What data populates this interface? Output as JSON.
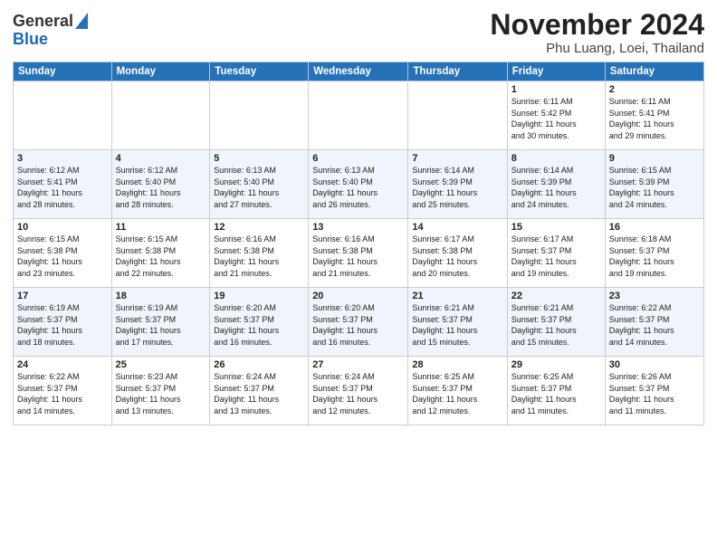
{
  "header": {
    "logo_general": "General",
    "logo_blue": "Blue",
    "month_title": "November 2024",
    "location": "Phu Luang, Loei, Thailand"
  },
  "days_of_week": [
    "Sunday",
    "Monday",
    "Tuesday",
    "Wednesday",
    "Thursday",
    "Friday",
    "Saturday"
  ],
  "weeks": [
    [
      {
        "day": "",
        "info": ""
      },
      {
        "day": "",
        "info": ""
      },
      {
        "day": "",
        "info": ""
      },
      {
        "day": "",
        "info": ""
      },
      {
        "day": "",
        "info": ""
      },
      {
        "day": "1",
        "info": "Sunrise: 6:11 AM\nSunset: 5:42 PM\nDaylight: 11 hours\nand 30 minutes."
      },
      {
        "day": "2",
        "info": "Sunrise: 6:11 AM\nSunset: 5:41 PM\nDaylight: 11 hours\nand 29 minutes."
      }
    ],
    [
      {
        "day": "3",
        "info": "Sunrise: 6:12 AM\nSunset: 5:41 PM\nDaylight: 11 hours\nand 28 minutes."
      },
      {
        "day": "4",
        "info": "Sunrise: 6:12 AM\nSunset: 5:40 PM\nDaylight: 11 hours\nand 28 minutes."
      },
      {
        "day": "5",
        "info": "Sunrise: 6:13 AM\nSunset: 5:40 PM\nDaylight: 11 hours\nand 27 minutes."
      },
      {
        "day": "6",
        "info": "Sunrise: 6:13 AM\nSunset: 5:40 PM\nDaylight: 11 hours\nand 26 minutes."
      },
      {
        "day": "7",
        "info": "Sunrise: 6:14 AM\nSunset: 5:39 PM\nDaylight: 11 hours\nand 25 minutes."
      },
      {
        "day": "8",
        "info": "Sunrise: 6:14 AM\nSunset: 5:39 PM\nDaylight: 11 hours\nand 24 minutes."
      },
      {
        "day": "9",
        "info": "Sunrise: 6:15 AM\nSunset: 5:39 PM\nDaylight: 11 hours\nand 24 minutes."
      }
    ],
    [
      {
        "day": "10",
        "info": "Sunrise: 6:15 AM\nSunset: 5:38 PM\nDaylight: 11 hours\nand 23 minutes."
      },
      {
        "day": "11",
        "info": "Sunrise: 6:15 AM\nSunset: 5:38 PM\nDaylight: 11 hours\nand 22 minutes."
      },
      {
        "day": "12",
        "info": "Sunrise: 6:16 AM\nSunset: 5:38 PM\nDaylight: 11 hours\nand 21 minutes."
      },
      {
        "day": "13",
        "info": "Sunrise: 6:16 AM\nSunset: 5:38 PM\nDaylight: 11 hours\nand 21 minutes."
      },
      {
        "day": "14",
        "info": "Sunrise: 6:17 AM\nSunset: 5:38 PM\nDaylight: 11 hours\nand 20 minutes."
      },
      {
        "day": "15",
        "info": "Sunrise: 6:17 AM\nSunset: 5:37 PM\nDaylight: 11 hours\nand 19 minutes."
      },
      {
        "day": "16",
        "info": "Sunrise: 6:18 AM\nSunset: 5:37 PM\nDaylight: 11 hours\nand 19 minutes."
      }
    ],
    [
      {
        "day": "17",
        "info": "Sunrise: 6:19 AM\nSunset: 5:37 PM\nDaylight: 11 hours\nand 18 minutes."
      },
      {
        "day": "18",
        "info": "Sunrise: 6:19 AM\nSunset: 5:37 PM\nDaylight: 11 hours\nand 17 minutes."
      },
      {
        "day": "19",
        "info": "Sunrise: 6:20 AM\nSunset: 5:37 PM\nDaylight: 11 hours\nand 16 minutes."
      },
      {
        "day": "20",
        "info": "Sunrise: 6:20 AM\nSunset: 5:37 PM\nDaylight: 11 hours\nand 16 minutes."
      },
      {
        "day": "21",
        "info": "Sunrise: 6:21 AM\nSunset: 5:37 PM\nDaylight: 11 hours\nand 15 minutes."
      },
      {
        "day": "22",
        "info": "Sunrise: 6:21 AM\nSunset: 5:37 PM\nDaylight: 11 hours\nand 15 minutes."
      },
      {
        "day": "23",
        "info": "Sunrise: 6:22 AM\nSunset: 5:37 PM\nDaylight: 11 hours\nand 14 minutes."
      }
    ],
    [
      {
        "day": "24",
        "info": "Sunrise: 6:22 AM\nSunset: 5:37 PM\nDaylight: 11 hours\nand 14 minutes."
      },
      {
        "day": "25",
        "info": "Sunrise: 6:23 AM\nSunset: 5:37 PM\nDaylight: 11 hours\nand 13 minutes."
      },
      {
        "day": "26",
        "info": "Sunrise: 6:24 AM\nSunset: 5:37 PM\nDaylight: 11 hours\nand 13 minutes."
      },
      {
        "day": "27",
        "info": "Sunrise: 6:24 AM\nSunset: 5:37 PM\nDaylight: 11 hours\nand 12 minutes."
      },
      {
        "day": "28",
        "info": "Sunrise: 6:25 AM\nSunset: 5:37 PM\nDaylight: 11 hours\nand 12 minutes."
      },
      {
        "day": "29",
        "info": "Sunrise: 6:25 AM\nSunset: 5:37 PM\nDaylight: 11 hours\nand 11 minutes."
      },
      {
        "day": "30",
        "info": "Sunrise: 6:26 AM\nSunset: 5:37 PM\nDaylight: 11 hours\nand 11 minutes."
      }
    ]
  ]
}
